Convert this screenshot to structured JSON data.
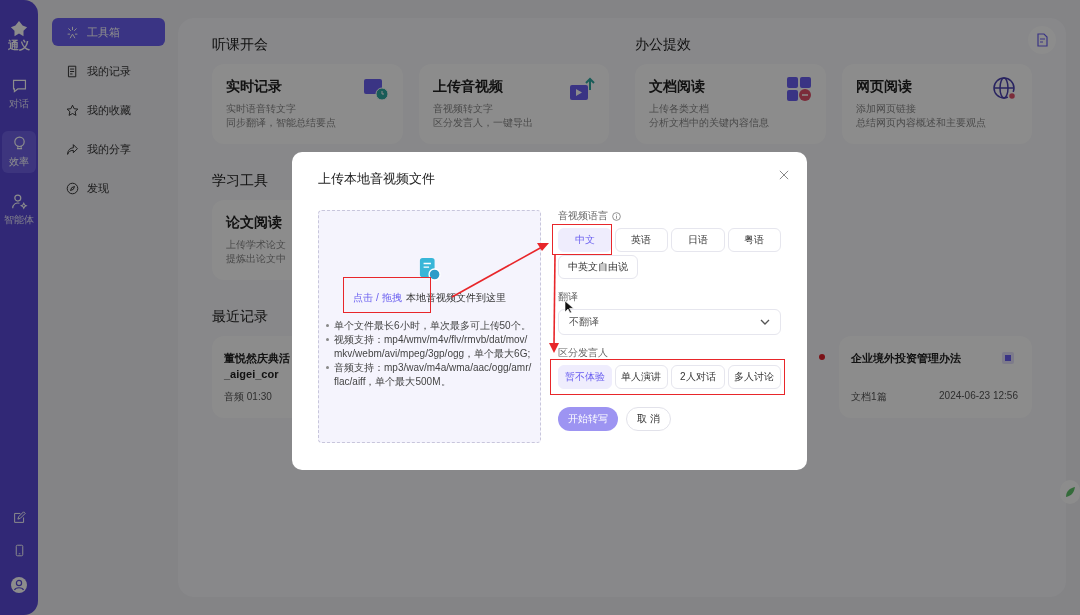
{
  "rail": {
    "logo": "通义",
    "items": [
      {
        "label": "对话",
        "selected": false
      },
      {
        "label": "效率",
        "selected": true
      },
      {
        "label": "智能体",
        "selected": false
      }
    ]
  },
  "nav": [
    {
      "label": "工具箱",
      "selected": true
    },
    {
      "label": "我的记录",
      "selected": false
    },
    {
      "label": "我的收藏",
      "selected": false
    },
    {
      "label": "我的分享",
      "selected": false
    },
    {
      "label": "发现",
      "selected": false
    }
  ],
  "groups": [
    {
      "title": "听课开会",
      "cards": [
        {
          "title": "实时记录",
          "lines": [
            "实时语音转文字",
            "同步翻译，智能总结要点"
          ]
        },
        {
          "title": "上传音视频",
          "lines": [
            "音视频转文字",
            "区分发言人，一键导出"
          ]
        }
      ]
    },
    {
      "title": "办公提效",
      "cards": [
        {
          "title": "文档阅读",
          "lines": [
            "上传各类文档",
            "分析文档中的关键内容信息"
          ]
        },
        {
          "title": "网页阅读",
          "lines": [
            "添加网页链接",
            "总结网页内容概述和主要观点"
          ]
        }
      ]
    }
  ],
  "study": {
    "title": "学习工具",
    "cards": [
      {
        "title": "论文阅读",
        "lines": [
          "上传学术论文",
          "提炼出论文中"
        ]
      }
    ]
  },
  "recent": {
    "title": "最近记录",
    "items": [
      {
        "title": "董悦然庆典活\n_aigei_cor",
        "meta": "音频 01:30"
      },
      {
        "title": "企业境外投资管理办法",
        "meta": "文档1篇",
        "date": "2024-06-23 12:56"
      }
    ]
  },
  "dialog": {
    "title": "上传本地音视频文件",
    "upload": {
      "link": "点击 / 拖拽",
      "text": "本地音视频文件到这里",
      "notes": [
        "单个文件最长6小时，单次最多可上传50个。",
        "视频支持：mp4/wmv/m4v/flv/rmvb/dat/mov/mkv/webm/avi/mpeg/3gp/ogg，单个最大6G;",
        "音频支持：mp3/wav/m4a/wma/aac/ogg/amr/flac/aiff，单个最大500M。"
      ]
    },
    "language": {
      "label": "音视频语言",
      "options": [
        {
          "label": "中文",
          "selected": true
        },
        {
          "label": "英语",
          "selected": false
        },
        {
          "label": "日语",
          "selected": false
        },
        {
          "label": "粤语",
          "selected": false
        },
        {
          "label": "中英文自由说",
          "selected": false
        }
      ]
    },
    "translate": {
      "label": "翻译",
      "value": "不翻译"
    },
    "speakers": {
      "label": "区分发言人",
      "options": [
        {
          "label": "暂不体验",
          "selected": true
        },
        {
          "label": "单人演讲",
          "selected": false
        },
        {
          "label": "2人对话",
          "selected": false
        },
        {
          "label": "多人讨论",
          "selected": false
        }
      ]
    },
    "start": {
      "label": "开始转写",
      "disabled": true
    },
    "cancel": "取 消"
  }
}
